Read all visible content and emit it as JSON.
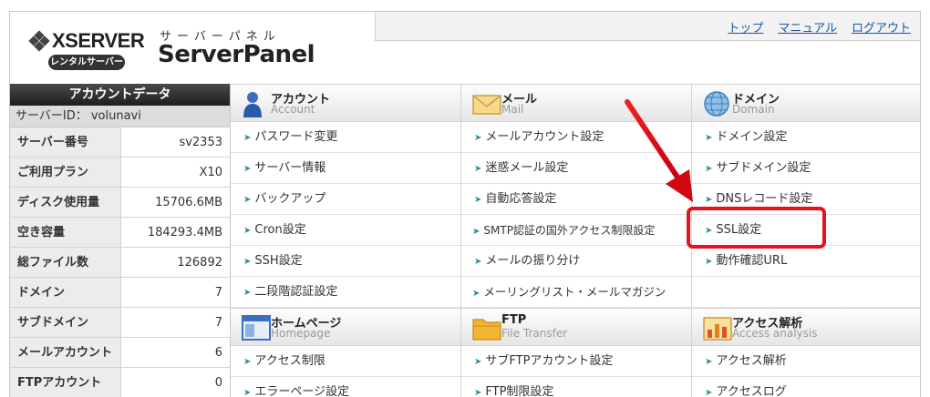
{
  "header": {
    "brand": "XSERVER",
    "badge": "レンタルサーバー",
    "subtitle": "サーバーパネル",
    "title": "ServerPanel",
    "links": [
      "トップ",
      "マニュアル",
      "ログアウト"
    ]
  },
  "account": {
    "heading": "アカウントデータ",
    "server_id": "サーバーID： volunavi",
    "rows": [
      {
        "label": "サーバー番号",
        "value": "sv2353"
      },
      {
        "label": "ご利用プラン",
        "value": "X10"
      },
      {
        "label": "ディスク使用量",
        "value": "15706.6MB"
      },
      {
        "label": "空き容量",
        "value": "184293.4MB"
      },
      {
        "label": "総ファイル数",
        "value": "126892"
      },
      {
        "label": "ドメイン",
        "value": "7"
      },
      {
        "label": "サブドメイン",
        "value": "7"
      },
      {
        "label": "メールアカウント",
        "value": "6"
      },
      {
        "label": "FTPアカウント",
        "value": "0"
      }
    ]
  },
  "menu": {
    "account": {
      "title": "アカウント",
      "subtitle": "Account",
      "items": [
        "パスワード変更",
        "サーバー情報",
        "バックアップ",
        "Cron設定",
        "SSH設定",
        "二段階認証設定"
      ]
    },
    "mail": {
      "title": "メール",
      "subtitle": "Mail",
      "items": [
        "メールアカウント設定",
        "迷惑メール設定",
        "自動応答設定",
        "SMTP認証の国外アクセス制限設定",
        "メールの振り分け",
        "メーリングリスト・メールマガジン"
      ]
    },
    "domain": {
      "title": "ドメイン",
      "subtitle": "Domain",
      "items": [
        "ドメイン設定",
        "サブドメイン設定",
        "DNSレコード設定",
        "SSL設定",
        "動作確認URL"
      ]
    },
    "homepage": {
      "title": "ホームページ",
      "subtitle": "Homepage",
      "items": [
        "アクセス制限",
        "エラーページ設定"
      ]
    },
    "ftp": {
      "title": "FTP",
      "subtitle": "File Transfer",
      "items": [
        "サブFTPアカウント設定",
        "FTP制限設定"
      ]
    },
    "access": {
      "title": "アクセス解析",
      "subtitle": "Access analysis",
      "items": [
        "アクセス解析",
        "アクセスログ"
      ]
    }
  },
  "colors": {
    "accent_link": "#1a57a8",
    "annotation_red": "#e8101a",
    "item_arrow": "#2a8a9a"
  }
}
